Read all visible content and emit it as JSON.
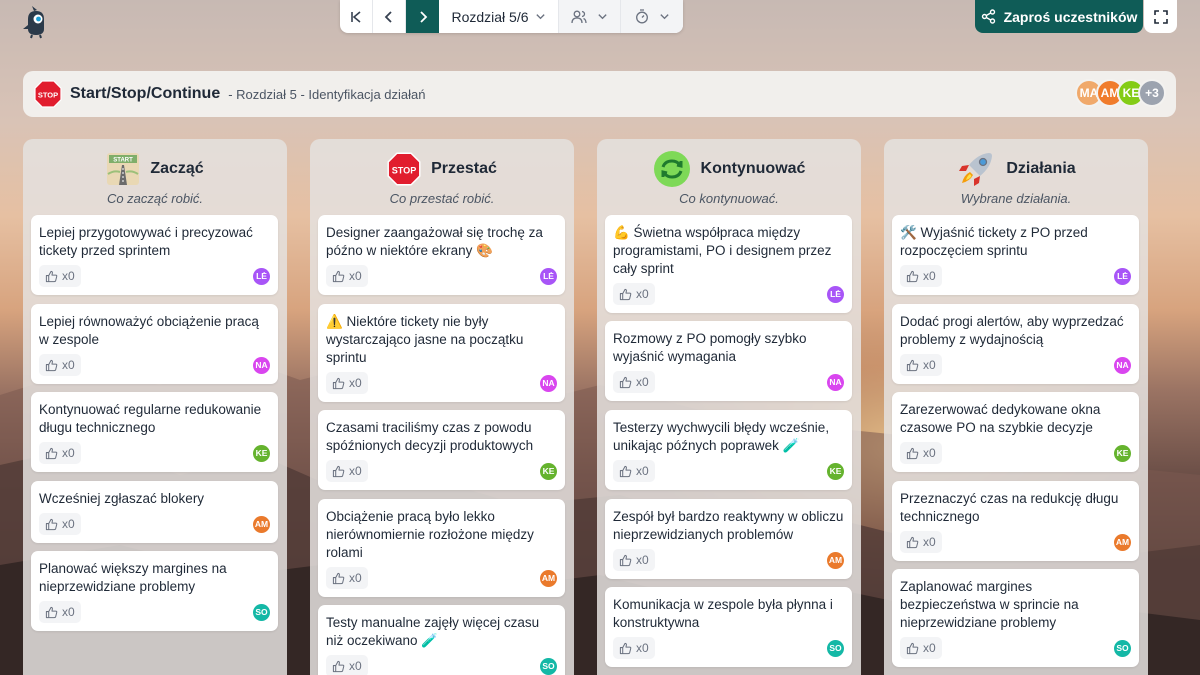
{
  "nav": {
    "chapter_label": "Rozdział 5/6"
  },
  "actions": {
    "invite_label": "Zaproś uczestników"
  },
  "header": {
    "stop_icon_text": "STOP",
    "title": "Start/Stop/Continue",
    "subtitle": "- Rozdział 5 - Identyfikacja działań"
  },
  "participants": [
    {
      "initials": "MA",
      "color": "#f0a96b"
    },
    {
      "initials": "AM",
      "color": "#f07c2c"
    },
    {
      "initials": "KE",
      "color": "#84cc16"
    },
    {
      "initials": "+3",
      "color": "#9ca3af"
    }
  ],
  "colors": {
    "LĖ": "#a855f7",
    "NA": "#d946ef",
    "KE": "#65b32e",
    "AM": "#ea7a2c",
    "SO": "#14b8a6"
  },
  "columns": [
    {
      "title": "Zacząć",
      "icon": "road-sign-icon",
      "icon_text": "START",
      "subtitle": "Co zacząć robić.",
      "cards": [
        {
          "text": "Lepiej przygotowywać i precyzować tickety przed sprintem",
          "likes": "x0",
          "author": "LĖ"
        },
        {
          "text": "Lepiej równoważyć obciążenie pracą w zespole",
          "likes": "x0",
          "author": "NA"
        },
        {
          "text": "Kontynuować regularne redukowanie długu technicznego",
          "likes": "x0",
          "author": "KE"
        },
        {
          "text": "Wcześniej zgłaszać blokery",
          "likes": "x0",
          "author": "AM"
        },
        {
          "text": "Planować większy margines na nieprzewidziane problemy",
          "likes": "x0",
          "author": "SO"
        }
      ]
    },
    {
      "title": "Przestać",
      "icon": "stop-sign-icon",
      "icon_text": "STOP",
      "subtitle": "Co przestać robić.",
      "cards": [
        {
          "text": "Designer zaangażował się trochę za późno w niektóre ekrany 🎨",
          "likes": "x0",
          "author": "LĖ"
        },
        {
          "text": "⚠️ Niektóre tickety nie były wystarczająco jasne na początku sprintu",
          "likes": "x0",
          "author": "NA"
        },
        {
          "text": "Czasami traciliśmy czas z powodu spóźnionych decyzji produktowych",
          "likes": "x0",
          "author": "KE"
        },
        {
          "text": "Obciążenie pracą było lekko nierównomiernie rozłożone między rolami",
          "likes": "x0",
          "author": "AM"
        },
        {
          "text": "Testy manualne zajęły więcej czasu niż oczekiwano 🧪",
          "likes": "x0",
          "author": "SO"
        }
      ]
    },
    {
      "title": "Kontynuować",
      "icon": "repeat-icon",
      "subtitle": "Co kontynuować.",
      "cards": [
        {
          "text": "💪 Świetna współpraca między programistami, PO i designem przez cały sprint",
          "likes": "x0",
          "author": "LĖ"
        },
        {
          "text": "Rozmowy z PO pomogły szybko wyjaśnić wymagania",
          "likes": "x0",
          "author": "NA"
        },
        {
          "text": "Testerzy wychwycili błędy wcześnie, unikając późnych poprawek 🧪",
          "likes": "x0",
          "author": "KE"
        },
        {
          "text": "Zespół był bardzo reaktywny w obliczu nieprzewidzianych problemów",
          "likes": "x0",
          "author": "AM"
        },
        {
          "text": "Komunikacja w zespole była płynna i konstruktywna",
          "likes": "x0",
          "author": "SO"
        }
      ]
    },
    {
      "title": "Działania",
      "icon": "rocket-icon",
      "subtitle": "Wybrane działania.",
      "cards": [
        {
          "text": "🛠️ Wyjaśnić tickety z PO przed rozpoczęciem sprintu",
          "likes": "x0",
          "author": "LĖ"
        },
        {
          "text": "Dodać progi alertów, aby wyprzedzać problemy z wydajnością",
          "likes": "x0",
          "author": "NA"
        },
        {
          "text": "Zarezerwować dedykowane okna czasowe PO na szybkie decyzje",
          "likes": "x0",
          "author": "KE"
        },
        {
          "text": "Przeznaczyć czas na redukcję długu technicznego",
          "likes": "x0",
          "author": "AM"
        },
        {
          "text": "Zaplanować margines bezpieczeństwa w sprincie na nieprzewidziane problemy",
          "likes": "x0",
          "author": "SO"
        }
      ]
    }
  ]
}
